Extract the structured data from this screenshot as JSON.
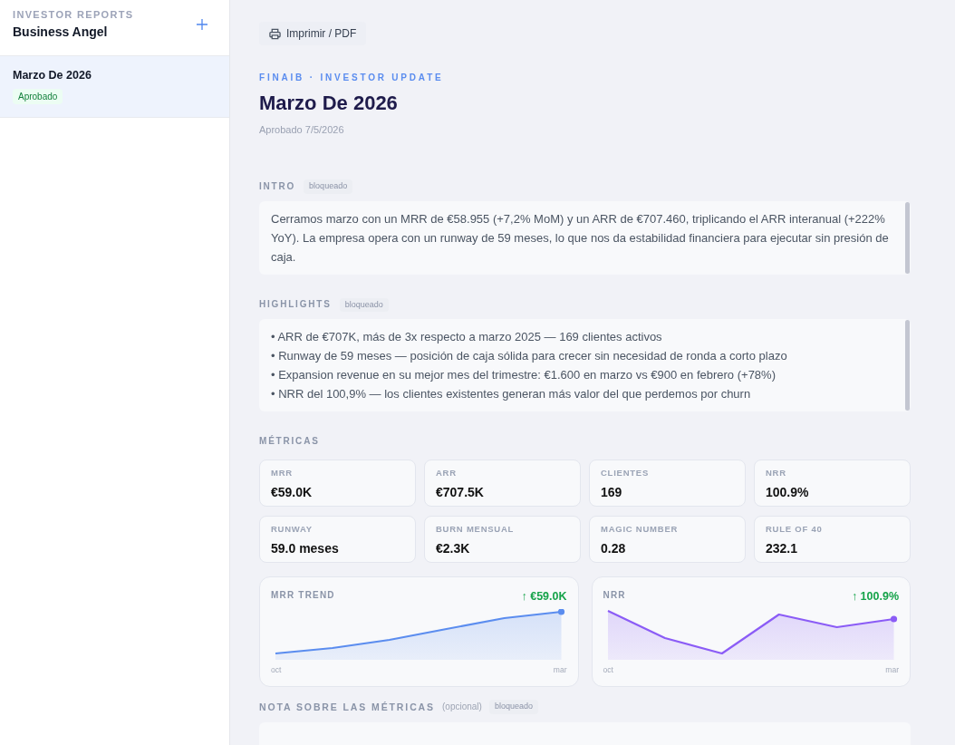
{
  "sidebar": {
    "eyebrow": "INVESTOR REPORTS",
    "title": "Business Angel",
    "reports": [
      {
        "title": "Marzo De 2026",
        "status": "Aprobado",
        "selected": true
      }
    ]
  },
  "toolbar": {
    "print_button": "Imprimir / PDF"
  },
  "report": {
    "eyebrow": "FINAIB · INVESTOR UPDATE",
    "title": "Marzo De 2026",
    "approved": "Aprobado 7/5/2026"
  },
  "sections": [
    {
      "kind": "text",
      "label": "INTRO",
      "badge": "bloqueado",
      "text": "Cerramos marzo con un MRR de €58.955 (+7,2% MoM) y un ARR de €707.460, triplicando el ARR interanual (+222% YoY). La empresa opera con un runway de 59 meses, lo que nos da estabilidad financiera para ejecutar sin presión de caja."
    },
    {
      "kind": "list",
      "label": "HIGHLIGHTS",
      "badge": "bloqueado",
      "items": [
        "• ARR de €707K, más de 3x respecto a marzo 2025 — 169 clientes activos",
        "• Runway de 59 meses — posición de caja sólida para crecer sin necesidad de ronda a corto plazo",
        "• Expansion revenue en su mejor mes del trimestre: €1.600 en marzo vs €900 en febrero (+78%)",
        "• NRR del 100,9% — los clientes existentes generan más valor del que perdemos por churn"
      ]
    }
  ],
  "metrics": {
    "label": "MÉTRICAS",
    "cards": [
      {
        "label": "MRR",
        "value": "€59.0K"
      },
      {
        "label": "ARR",
        "value": "€707.5K"
      },
      {
        "label": "CLIENTES",
        "value": "169"
      },
      {
        "label": "NRR",
        "value": "100.9%"
      },
      {
        "label": "RUNWAY",
        "value": "59.0 meses"
      },
      {
        "label": "BURN MENSUAL",
        "value": "€2.3K"
      },
      {
        "label": "MAGIC NUMBER",
        "value": "0.28"
      },
      {
        "label": "RULE OF 40",
        "value": "232.1"
      }
    ],
    "charts": [
      {
        "title": "MRR TREND",
        "value": "↑ €59.0K",
        "start": "oct",
        "end": "mar",
        "color": "#5b8def"
      },
      {
        "title": "NRR",
        "value": "↑ 100.9%",
        "start": "oct",
        "end": "mar",
        "color": "#8b5cf6"
      }
    ]
  },
  "note": {
    "label": "NOTA SOBRE LAS MÉTRICAS",
    "hint": "(opcional)",
    "badge": "bloqueado"
  }
}
